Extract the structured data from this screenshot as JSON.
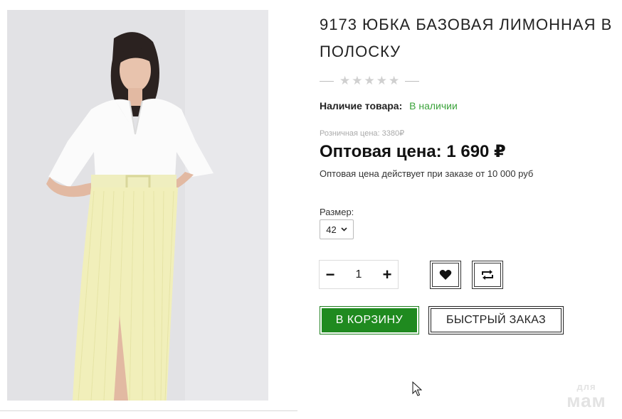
{
  "product": {
    "title": "9173 ЮБКА БАЗОВАЯ ЛИМОННАЯ В ПОЛОСКУ",
    "rating_stars": [
      "★",
      "★",
      "★",
      "★",
      "★"
    ],
    "rating_value": 0,
    "availability_label": "Наличие товара:",
    "availability_value": "В наличии",
    "retail_price": "Розничная цена: 3380₽",
    "wholesale_price": "Оптовая цена: 1 690 ₽",
    "wholesale_note": "Оптовая цена действует при заказе от 10 000 руб",
    "size_label": "Размер:",
    "size_selected": "42",
    "quantity": "1"
  },
  "controls": {
    "minus": "−",
    "plus": "+",
    "wishlist_icon": "heart-icon",
    "compare_icon": "compare-icon",
    "add_to_cart": "В КОРЗИНУ",
    "quick_order": "БЫСТРЫЙ ЗАКАЗ"
  },
  "watermark": {
    "line1": "для",
    "line2": "мам"
  },
  "colors": {
    "accent_green": "#1f8a1f",
    "availability_green": "#3ba33b",
    "star_empty": "#d0d0d0"
  }
}
